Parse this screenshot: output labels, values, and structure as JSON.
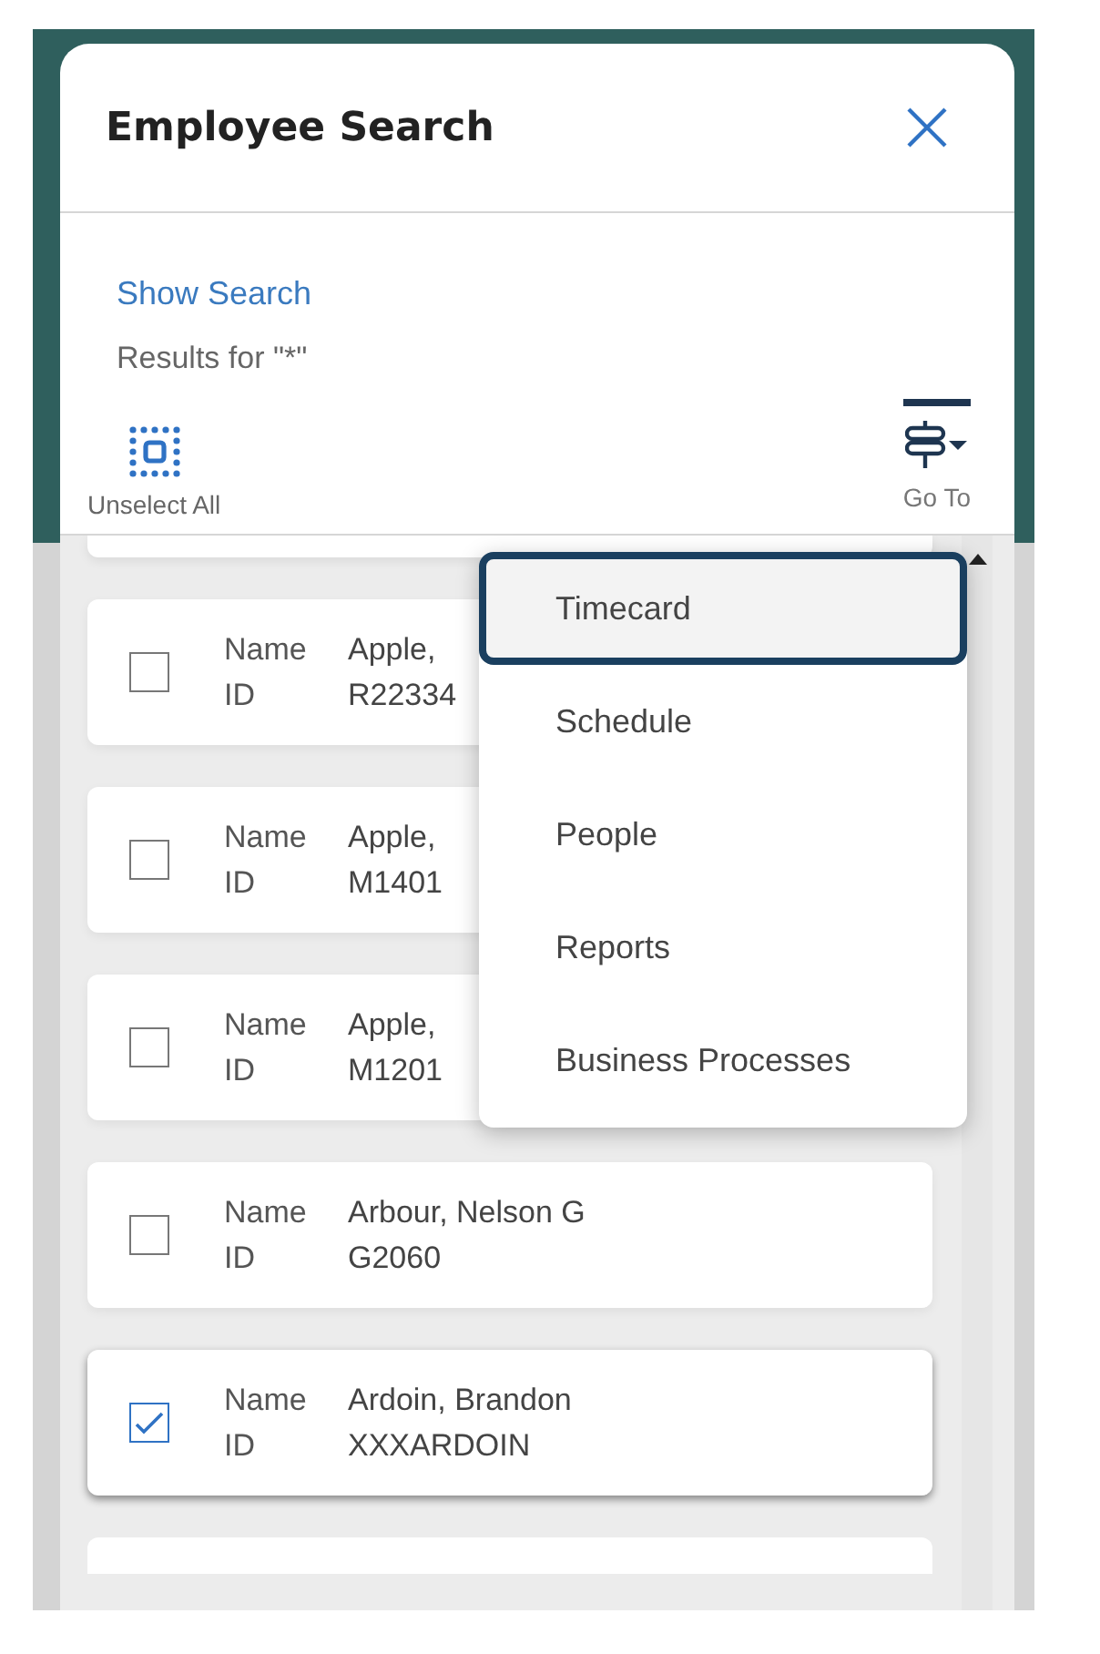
{
  "dialog": {
    "title": "Employee Search"
  },
  "search": {
    "show_search_link": "Show Search",
    "results_text": "Results for \"*\""
  },
  "toolbar": {
    "unselect_all": "Unselect All",
    "go_to": {
      "label": "Go To",
      "expanded": true
    }
  },
  "employees": [
    {
      "name_label": "Name",
      "name": "Apple,",
      "id_label": "ID",
      "id": "R22334",
      "checked": false
    },
    {
      "name_label": "Name",
      "name": "Apple,",
      "id_label": "ID",
      "id": "M1401",
      "checked": false
    },
    {
      "name_label": "Name",
      "name": "Apple,",
      "id_label": "ID",
      "id": "M1201",
      "checked": false
    },
    {
      "name_label": "Name",
      "name": "Arbour, Nelson G",
      "id_label": "ID",
      "id": "G2060",
      "checked": false
    },
    {
      "name_label": "Name",
      "name": "Ardoin, Brandon",
      "id_label": "ID",
      "id": "XXXARDOIN",
      "checked": true
    }
  ],
  "go_to_menu": [
    {
      "label": "Timecard",
      "selected": true
    },
    {
      "label": "Schedule",
      "selected": false
    },
    {
      "label": "People",
      "selected": false
    },
    {
      "label": "Reports",
      "selected": false
    },
    {
      "label": "Business Processes",
      "selected": false
    }
  ]
}
